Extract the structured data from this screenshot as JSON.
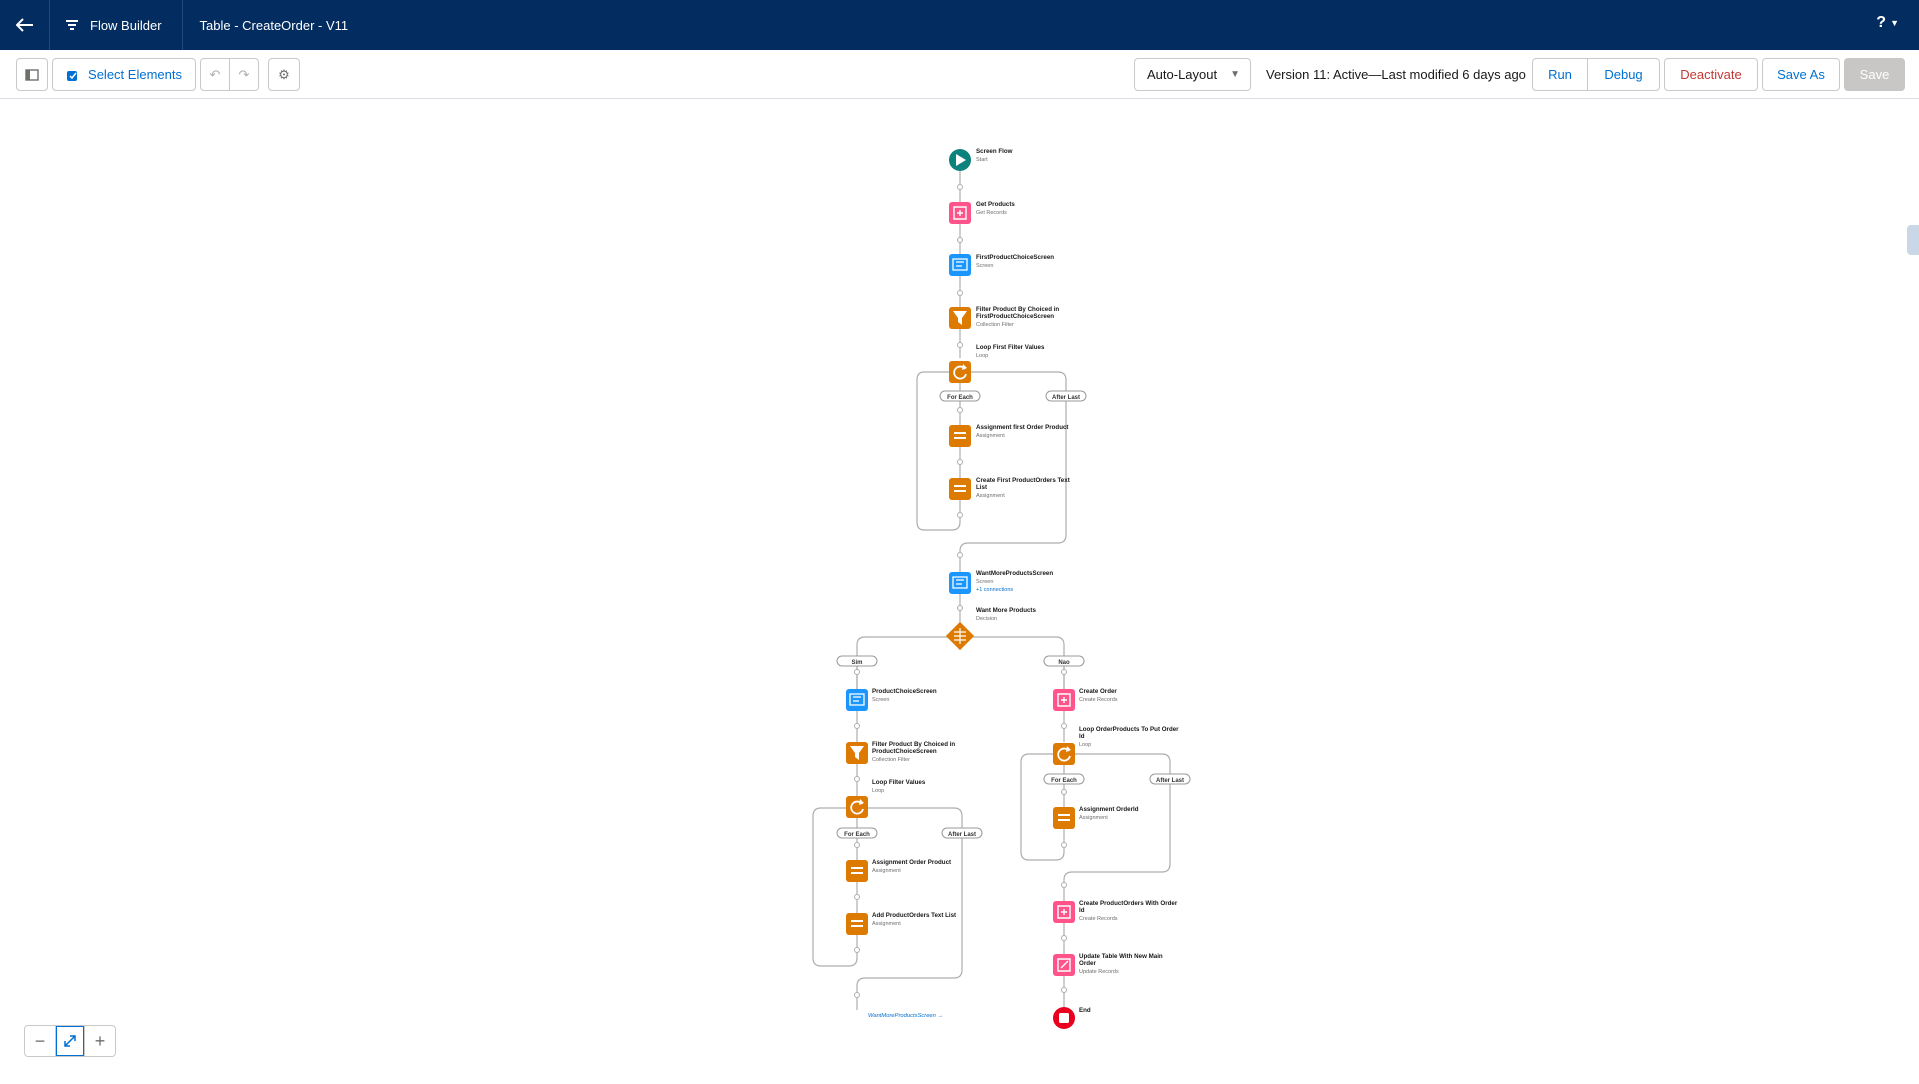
{
  "header": {
    "app_name": "Flow Builder",
    "flow_title": "Table - CreateOrder - V11",
    "help_label": "?"
  },
  "toolbar": {
    "select_elements_label": "Select Elements",
    "layout_value": "Auto-Layout",
    "version_text": "Version 11: Active—Last modified 6 days ago",
    "run_label": "Run",
    "debug_label": "Debug",
    "deactivate_label": "Deactivate",
    "save_as_label": "Save As",
    "save_label": "Save"
  },
  "colors": {
    "header_bg": "#032d60",
    "start": "#0b827c",
    "records": "#ff538a",
    "screen": "#1b96ff",
    "logic": "#dd7a01",
    "end": "#ea001e",
    "link": "#0070d2"
  },
  "flow": {
    "nodes": [
      {
        "id": "start",
        "title": "Screen Flow",
        "subtitle": "Start",
        "kind": "start",
        "icon": "play-icon"
      },
      {
        "id": "get_products",
        "title": "Get Products",
        "subtitle": "Get Records",
        "kind": "records",
        "icon": "get-records-icon"
      },
      {
        "id": "first_choice",
        "title": "FirstProductChoiceScreen",
        "subtitle": "Screen",
        "kind": "screen",
        "icon": "screen-icon"
      },
      {
        "id": "filter1",
        "title": "Filter Product By Choiced in",
        "title2": "FirstProductChoiceScreen",
        "subtitle": "Collection Filter",
        "kind": "logic",
        "icon": "filter-icon"
      },
      {
        "id": "loop1",
        "title": "Loop First Filter Values",
        "subtitle": "Loop",
        "kind": "logic",
        "icon": "loop-icon"
      },
      {
        "id": "assign1",
        "title": "Assignment first Order Product",
        "subtitle": "Assignment",
        "kind": "logic",
        "icon": "assignment-icon"
      },
      {
        "id": "assign2",
        "title": "Create First ProductOrders Text",
        "title2": "List",
        "subtitle": "Assignment",
        "kind": "logic",
        "icon": "assignment-icon"
      },
      {
        "id": "want_screen",
        "title": "WantMoreProductsScreen",
        "subtitle": "Screen",
        "extra": "+1 connections",
        "kind": "screen",
        "icon": "screen-icon"
      },
      {
        "id": "decision",
        "title": "Want More Products",
        "subtitle": "Decision",
        "kind": "decision",
        "icon": "decision-icon"
      },
      {
        "id": "product_choice",
        "title": "ProductChoiceScreen",
        "subtitle": "Screen",
        "kind": "screen",
        "icon": "screen-icon"
      },
      {
        "id": "filter2",
        "title": "Filter Product By Choiced in",
        "title2": "ProductChoiceScreen",
        "subtitle": "Collection Filter",
        "kind": "logic",
        "icon": "filter-icon"
      },
      {
        "id": "loop2",
        "title": "Loop Filter Values",
        "subtitle": "Loop",
        "kind": "logic",
        "icon": "loop-icon"
      },
      {
        "id": "assign3",
        "title": "Assignment Order Product",
        "subtitle": "Assignment",
        "kind": "logic",
        "icon": "assignment-icon"
      },
      {
        "id": "assign4",
        "title": "Add ProductOrders Text List",
        "subtitle": "Assignment",
        "kind": "logic",
        "icon": "assignment-icon"
      },
      {
        "id": "create_order",
        "title": "Create Order",
        "subtitle": "Create Records",
        "kind": "records",
        "icon": "create-records-icon"
      },
      {
        "id": "loop3",
        "title": "Loop OrderProducts To Put Order",
        "title2": "Id",
        "subtitle": "Loop",
        "kind": "logic",
        "icon": "loop-icon"
      },
      {
        "id": "assign5",
        "title": "Assignment OrderId",
        "subtitle": "Assignment",
        "kind": "logic",
        "icon": "assignment-icon"
      },
      {
        "id": "create_po",
        "title": "Create ProductOrders With Order",
        "title2": "Id",
        "subtitle": "Create Records",
        "kind": "records",
        "icon": "create-records-icon"
      },
      {
        "id": "update_table",
        "title": "Update Table With New Main",
        "title2": "Order",
        "subtitle": "Update Records",
        "kind": "records",
        "icon": "update-records-icon"
      },
      {
        "id": "end",
        "title": "End",
        "subtitle": "",
        "kind": "end",
        "icon": "stop-icon"
      }
    ],
    "pills": {
      "for_each": "For Each",
      "after_last": "After Last",
      "sim": "Sim",
      "nao": "Nao"
    },
    "goto_label": "WantMoreProductsScreen →"
  },
  "zoom": {
    "zoom_out": "−",
    "zoom_in": "+"
  }
}
